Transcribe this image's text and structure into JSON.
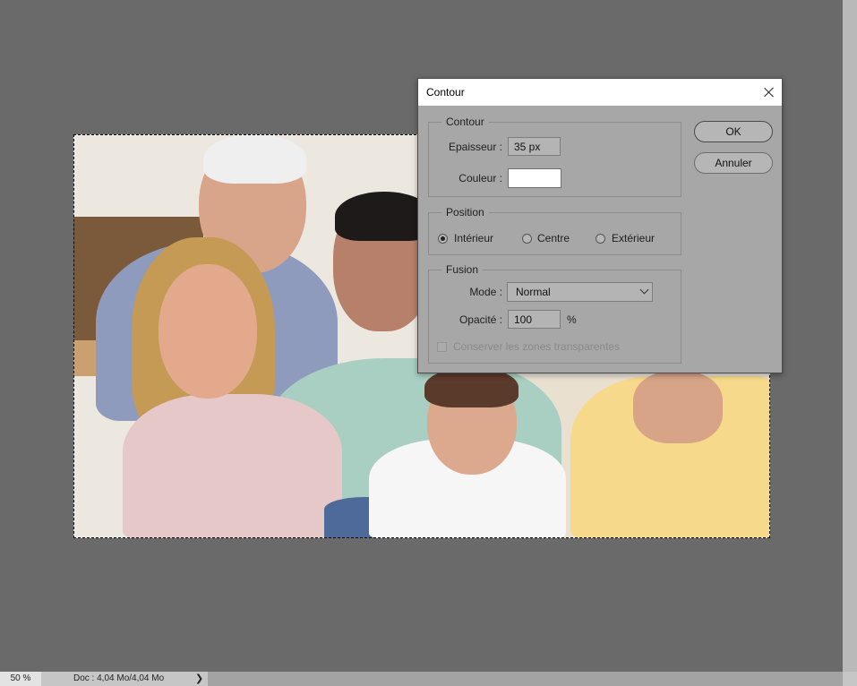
{
  "dialog": {
    "title": "Contour",
    "ok_label": "OK",
    "cancel_label": "Annuler",
    "contour_group": {
      "legend": "Contour",
      "thickness_label": "Epaisseur :",
      "thickness_value": "35 px",
      "color_label": "Couleur :",
      "color_value": "#ffffff"
    },
    "position_group": {
      "legend": "Position",
      "options": [
        "Intérieur",
        "Centre",
        "Extérieur"
      ],
      "selected": "Intérieur"
    },
    "fusion_group": {
      "legend": "Fusion",
      "mode_label": "Mode :",
      "mode_value": "Normal",
      "opacity_label": "Opacité :",
      "opacity_value": "100",
      "opacity_unit": "%",
      "preserve_label": "Conserver les zones transparentes",
      "preserve_checked": false,
      "preserve_disabled": true
    }
  },
  "statusbar": {
    "zoom": "50 %",
    "doc_info": "Doc : 4,04 Mo/4,04 Mo",
    "arrow": "❯"
  }
}
